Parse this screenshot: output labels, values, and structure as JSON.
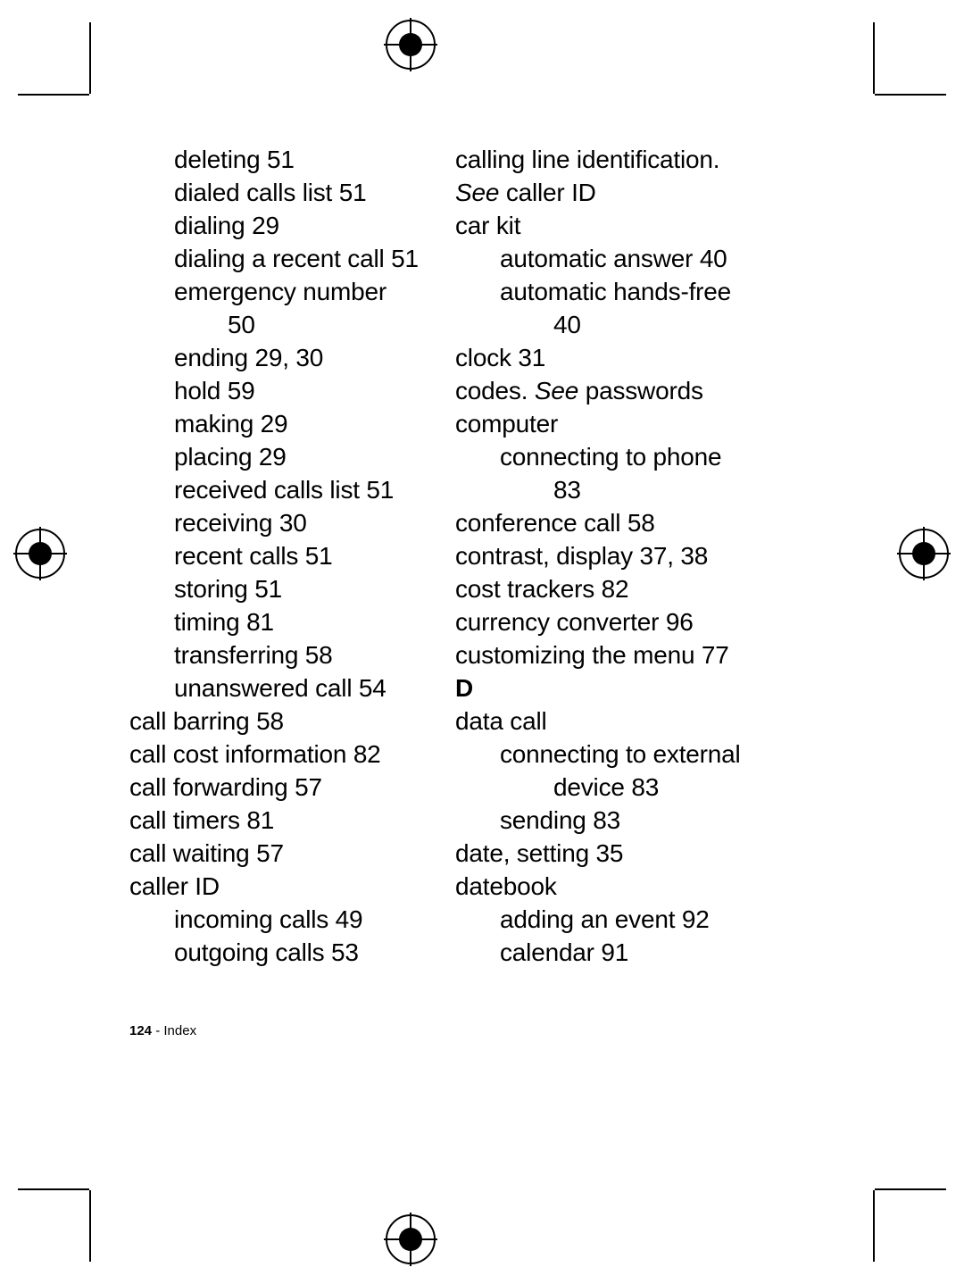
{
  "col_left": {
    "e1": "deleting 51",
    "e2": "dialed calls list 51",
    "e3": "dialing 29",
    "e4": "dialing a recent call 51",
    "e5a": "emergency number",
    "e5b": "50",
    "e6": "ending 29, 30",
    "e7": "hold 59",
    "e8": "making 29",
    "e9": "placing 29",
    "e10": "received calls list 51",
    "e11": "receiving 30",
    "e12": "recent calls 51",
    "e13": "storing 51",
    "e14": "timing 81",
    "e15": "transferring 58",
    "e16": "unanswered call 54",
    "e17": "call barring 58",
    "e18": "call cost information 82",
    "e19": "call forwarding 57",
    "e20": "call timers 81",
    "e21": "call waiting 57",
    "e22": "caller ID",
    "e23": "incoming calls 49",
    "e24": "outgoing calls 53"
  },
  "col_right": {
    "r1a": "calling line identification. ",
    "r1b": "See",
    "r1c": " caller ID",
    "r2": "car kit",
    "r3": "automatic answer 40",
    "r4a": "automatic hands-free",
    "r4b": "40",
    "r5": "clock 31",
    "r6a": "codes. ",
    "r6b": "See",
    "r6c": " passwords",
    "r7": "computer",
    "r8a": "connecting to phone",
    "r8b": "83",
    "r9": "conference call 58",
    "r10": "contrast, display 37, 38",
    "r11": "cost trackers 82",
    "r12": "currency converter 96",
    "r13": "customizing the menu 77",
    "letterD": "D",
    "r14": "data call",
    "r15a": "connecting to external",
    "r15b": "device 83",
    "r16": "sending 83",
    "r17": "date, setting 35",
    "r18": "datebook",
    "r19": "adding an event 92",
    "r20": "calendar 91"
  },
  "footer": {
    "page_number": "124",
    "separator": " - ",
    "label": "Index"
  }
}
